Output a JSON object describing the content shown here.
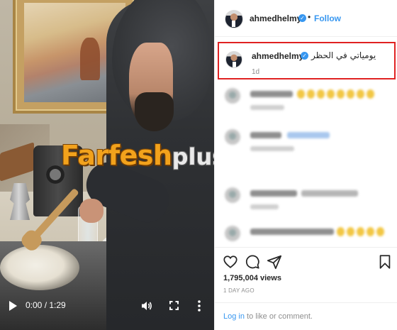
{
  "video": {
    "watermark_brand": "Farfesh",
    "watermark_suffix": "plus.com",
    "time_display": "0:00 / 1:29",
    "icons": {
      "play": "play-icon",
      "volume": "volume-icon",
      "fullscreen": "fullscreen-icon",
      "more": "more-vertical-icon"
    }
  },
  "header": {
    "username": "ahmedhelmy",
    "separator": "•",
    "follow_label": "Follow"
  },
  "caption": {
    "username": "ahmedhelmy",
    "text": "يومياتي في الحظر",
    "time": "1d"
  },
  "stats": {
    "views": "1,795,004 views",
    "date": "1 DAY AGO"
  },
  "login": {
    "link_text": "Log in",
    "rest_text": " to like or comment."
  },
  "colors": {
    "accent": "#3897f0",
    "highlight_box": "#e02222",
    "watermark_orange": "#f2a21c"
  }
}
